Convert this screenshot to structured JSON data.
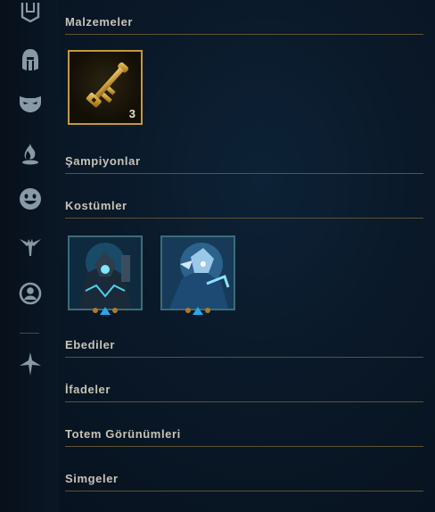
{
  "sidebar": {
    "icons": [
      "inventory-icon",
      "helmet-icon",
      "mask-icon",
      "fire-icon",
      "smiley-icon",
      "ward-totem-icon",
      "profile-icon",
      "eternals-icon"
    ]
  },
  "sections": {
    "materials": {
      "label": "Malzemeler"
    },
    "champions": {
      "label": "Şampiyonlar"
    },
    "skins": {
      "label": "Kostümler"
    },
    "eternals": {
      "label": "Ebediler"
    },
    "emotes": {
      "label": "İfadeler"
    },
    "ward_skins": {
      "label": "Totem Görünümleri"
    },
    "icons": {
      "label": "Simgeler"
    }
  },
  "materials": {
    "items": [
      {
        "icon": "key-fragment-icon",
        "count": "3"
      }
    ]
  },
  "colors": {
    "accent_gold": "#c09a3c",
    "divider": "#5e5232",
    "label_text": "#c8c3b6",
    "skin_border": "#3c6c78"
  }
}
